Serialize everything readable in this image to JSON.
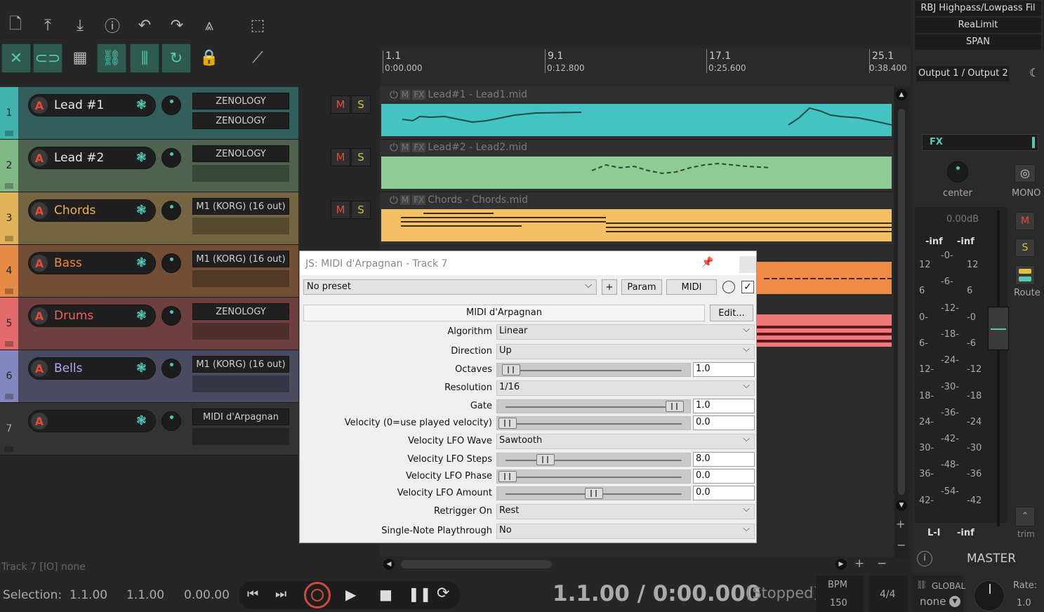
{
  "toolbar": {
    "icons": [
      "new-file-icon",
      "import-icon",
      "export-icon",
      "info-icon",
      "undo-icon",
      "redo-icon",
      "metronome-icon",
      "marquee-icon"
    ],
    "icons2": [
      "ripple-icon",
      "link-icon",
      "grid-icon",
      "group-icon",
      "snap-grid-icon",
      "loop-icon",
      "lock-icon",
      "envelope-icon"
    ]
  },
  "ruler": {
    "marks": [
      {
        "bar": "1.1",
        "time": "0:00.000"
      },
      {
        "bar": "9.1",
        "time": "0:12.800"
      },
      {
        "bar": "17.1",
        "time": "0:25.600"
      },
      {
        "bar": "25.1",
        "time": "0:38.400"
      }
    ]
  },
  "tracks": [
    {
      "num": "1",
      "name": "Lead #1",
      "fx": [
        "ZENOLOGY",
        "ZENOLOGY"
      ],
      "color": "#3fb3ac",
      "name_color": "#e8e8e8",
      "ms": true
    },
    {
      "num": "2",
      "name": "Lead #2",
      "fx": [
        "ZENOLOGY",
        ""
      ],
      "color": "#7fb885",
      "name_color": "#e8e8e8",
      "ms": true
    },
    {
      "num": "3",
      "name": "Chords",
      "fx": [
        "M1 (KORG) (16 out)",
        ""
      ],
      "color": "#e1b45a",
      "name_color": "#f0b340",
      "ms": true
    },
    {
      "num": "4",
      "name": "Bass",
      "fx": [
        "M1 (KORG) (16 out)",
        ""
      ],
      "color": "#e68b45",
      "name_color": "#f08a3a",
      "ms": false
    },
    {
      "num": "5",
      "name": "Drums",
      "fx": [
        "ZENOLOGY",
        ""
      ],
      "color": "#e36a6a",
      "name_color": "#f06060",
      "ms": false
    },
    {
      "num": "6",
      "name": "Bells",
      "fx": [
        "M1 (KORG) (16 out)",
        ""
      ],
      "color": "#8487bd",
      "name_color": "#a9acf0",
      "ms": false
    },
    {
      "num": "7",
      "name": "",
      "fx": [
        "MIDI d'Arpagnan",
        ""
      ],
      "color": "#3a3a3a",
      "name_color": "#e8e8e8",
      "ms": false
    }
  ],
  "ms_labels": {
    "m": "M",
    "s": "S"
  },
  "clips": [
    {
      "label": "Lead#1 - Lead1.mid",
      "color": "#45c3c3"
    },
    {
      "label": "Lead#2 - Lead2.mid",
      "color": "#8ecb95"
    },
    {
      "label": "Chords - Chords.mid",
      "color": "#f4c064"
    }
  ],
  "clip_btn": {
    "m": "M",
    "fx": "FX"
  },
  "fx_window": {
    "title": "JS: MIDI d'Arpagnan - Track 7",
    "preset": "No preset",
    "plus": "+",
    "param": "Param",
    "midi": "MIDI",
    "plugin_name": "MIDI d'Arpagnan",
    "edit": "Edit...",
    "params": [
      {
        "label": "Algorithm",
        "kind": "select",
        "value": "Linear"
      },
      {
        "label": "Direction",
        "kind": "select",
        "value": "Up"
      },
      {
        "label": "Octaves",
        "kind": "slider",
        "value": "1.0",
        "pos": 0.02
      },
      {
        "label": "Resolution",
        "kind": "select",
        "value": "1/16"
      },
      {
        "label": "Gate",
        "kind": "slider",
        "value": "1.0",
        "pos": 0.97
      },
      {
        "label": "Velocity (0=use played velocity)",
        "kind": "slider",
        "value": "0.0",
        "pos": 0.0
      },
      {
        "label": "Velocity LFO Wave",
        "kind": "select",
        "value": "Sawtooth"
      },
      {
        "label": "Velocity LFO Steps",
        "kind": "slider",
        "value": "8.0",
        "pos": 0.22
      },
      {
        "label": "Velocity LFO Phase",
        "kind": "slider",
        "value": "0.0",
        "pos": 0.0
      },
      {
        "label": "Velocity LFO Amount",
        "kind": "slider",
        "value": "0.0",
        "pos": 0.5
      },
      {
        "label": "Retrigger On",
        "kind": "select",
        "value": "Rest"
      },
      {
        "label": "Single-Note Playthrough",
        "kind": "select",
        "value": "No"
      }
    ]
  },
  "master": {
    "fx_list": [
      "RBJ Highpass/Lowpass Fil",
      "ReaLimit",
      "SPAN"
    ],
    "output": "Output 1 / Output 2",
    "fx_label": "FX",
    "pan_label": "center",
    "mono": "MONO",
    "db": "0.00dB",
    "peak_l": "-inf",
    "peak_r": "-inf",
    "m": "M",
    "s": "S",
    "route": "Route",
    "trim": "trim",
    "scale_left": [
      "12",
      "6",
      "0-",
      "6-",
      "12-",
      "18-",
      "24-",
      "30-",
      "36-",
      "42-"
    ],
    "scale_mid": [
      "-0-",
      "-6-",
      "-12-",
      "-18-",
      "-24-",
      "-30-",
      "-36-",
      "-42-",
      "-48-",
      "-54-"
    ],
    "scale_right": [
      "12",
      "6",
      "-0",
      "-6",
      "-12",
      "-18",
      "-24",
      "-30",
      "-36",
      "-42"
    ],
    "li": "L-I",
    "inf": "-inf",
    "label": "MASTER"
  },
  "status": {
    "track_io": "Track 7 [IO] none"
  },
  "transport": {
    "selection_label": "Selection:",
    "sel_start": "1.1.00",
    "sel_end": "1.1.00",
    "sel_len": "0.00.00",
    "position": "1.1.00 / 0:00.000",
    "state": "[Stopped]",
    "bpm_label": "BPM",
    "bpm": "150",
    "timesig": "4/4",
    "global": "GLOBAL",
    "none": "none",
    "rate_label": "Rate:",
    "rate": "1.0"
  }
}
